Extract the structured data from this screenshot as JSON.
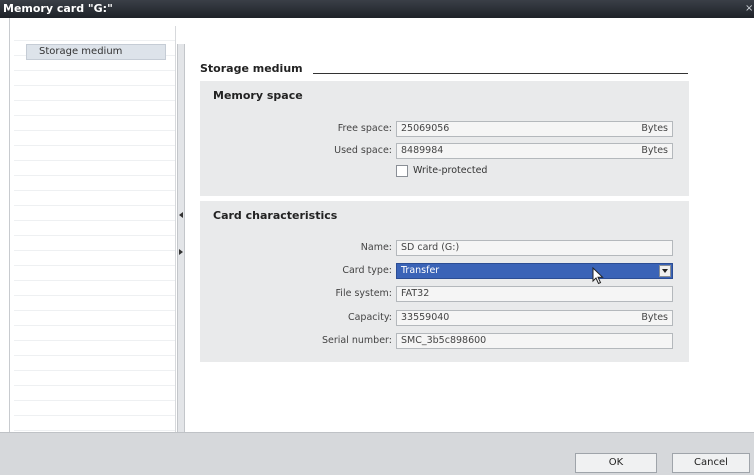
{
  "window": {
    "title": "Memory card \"G:\"",
    "close_glyph": "×"
  },
  "nav": {
    "items": [
      {
        "label": "Storage medium",
        "selected": true
      }
    ]
  },
  "page": {
    "section_title": "Storage medium",
    "memory_space": {
      "title": "Memory space",
      "free_space": {
        "label": "Free space:",
        "value": "25069056",
        "unit": "Bytes"
      },
      "used_space": {
        "label": "Used space:",
        "value": "8489984",
        "unit": "Bytes"
      },
      "write_protected": {
        "label": "Write-protected",
        "checked": false
      }
    },
    "card": {
      "title": "Card characteristics",
      "name": {
        "label": "Name:",
        "value": "SD card (G:)"
      },
      "card_type": {
        "label": "Card type:",
        "value": "Transfer"
      },
      "file_system": {
        "label": "File system:",
        "value": "FAT32"
      },
      "capacity": {
        "label": "Capacity:",
        "value": "33559040",
        "unit": "Bytes"
      },
      "serial_number": {
        "label": "Serial number:",
        "value": "SMC_3b5c898600"
      }
    }
  },
  "buttons": {
    "ok": "OK",
    "cancel": "Cancel"
  },
  "colors": {
    "selected_dropdown": "#3a63b7",
    "group_background": "#e9eaeb",
    "titlebar": "#1e2228"
  }
}
